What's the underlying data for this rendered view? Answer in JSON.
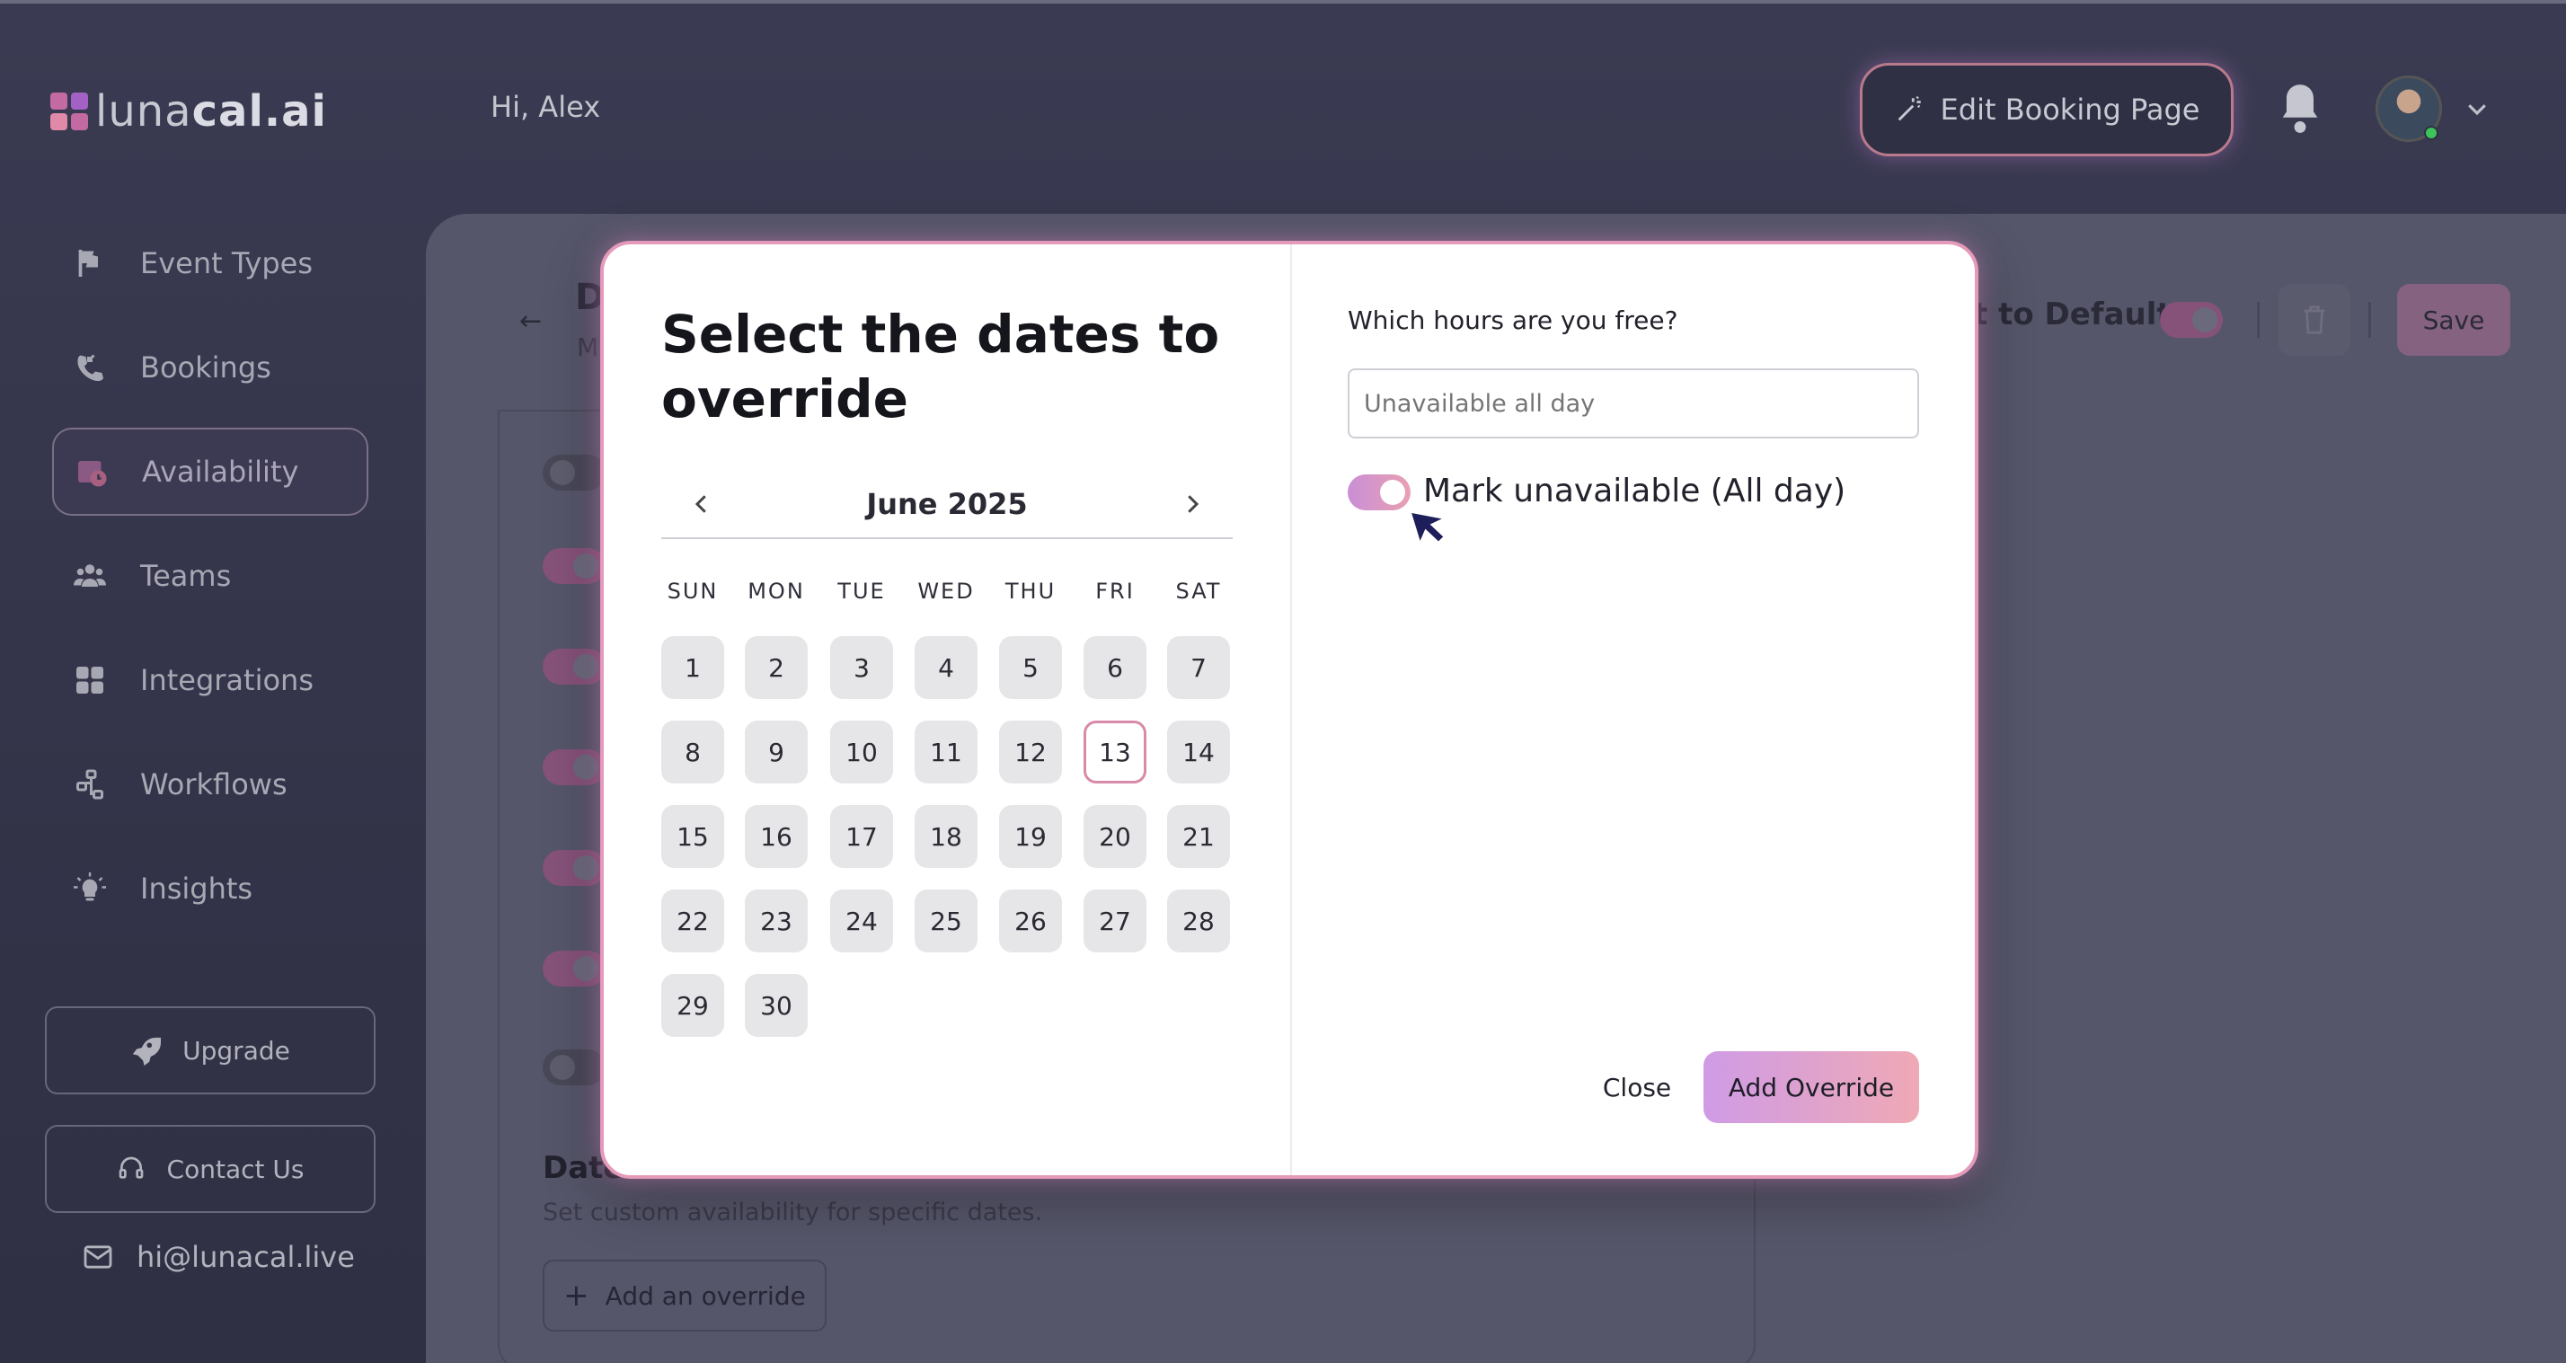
{
  "header": {
    "logo_text_light": "luna",
    "logo_text_bold": "cal.ai",
    "greeting": "Hi, Alex",
    "edit_booking_label": "Edit Booking Page"
  },
  "sidebar": {
    "items": [
      {
        "label": "Event Types",
        "icon": "flag-icon"
      },
      {
        "label": "Bookings",
        "icon": "phone-icon"
      },
      {
        "label": "Availability",
        "icon": "calendar-clock-icon",
        "active": true
      },
      {
        "label": "Teams",
        "icon": "users-icon"
      },
      {
        "label": "Integrations",
        "icon": "grid-icon"
      },
      {
        "label": "Workflows",
        "icon": "workflow-icon"
      },
      {
        "label": "Insights",
        "icon": "lightbulb-icon"
      }
    ],
    "upgrade_label": "Upgrade",
    "contact_label": "Contact Us",
    "email": "hi@lunacal.live"
  },
  "page": {
    "title_fragment": "D",
    "subtitle_fragment": "M",
    "reset_label": "t to Default",
    "save_label": "Save",
    "date_overrides_title": "Date",
    "date_overrides_subtitle": "Set custom availability for specific dates.",
    "add_override_label": "Add an override"
  },
  "modal": {
    "title": "Select the dates to override",
    "month": "June 2025",
    "weekdays": [
      "SUN",
      "MON",
      "TUE",
      "WED",
      "THU",
      "FRI",
      "SAT"
    ],
    "days": [
      "1",
      "2",
      "3",
      "4",
      "5",
      "6",
      "7",
      "8",
      "9",
      "10",
      "11",
      "12",
      "13",
      "14",
      "15",
      "16",
      "17",
      "18",
      "19",
      "20",
      "21",
      "22",
      "23",
      "24",
      "25",
      "26",
      "27",
      "28",
      "29",
      "30"
    ],
    "today": "13",
    "question": "Which hours are you free?",
    "hours_placeholder": "Unavailable all day",
    "toggle_label": "Mark unavailable (All day)",
    "toggle_on": true,
    "close_label": "Close",
    "add_override_label": "Add Override"
  },
  "colors": {
    "accent_gradient_start": "#cf9be6",
    "accent_gradient_end": "#efa9b5",
    "modal_border": "#e49ab8",
    "today_border": "#d98aa8"
  }
}
